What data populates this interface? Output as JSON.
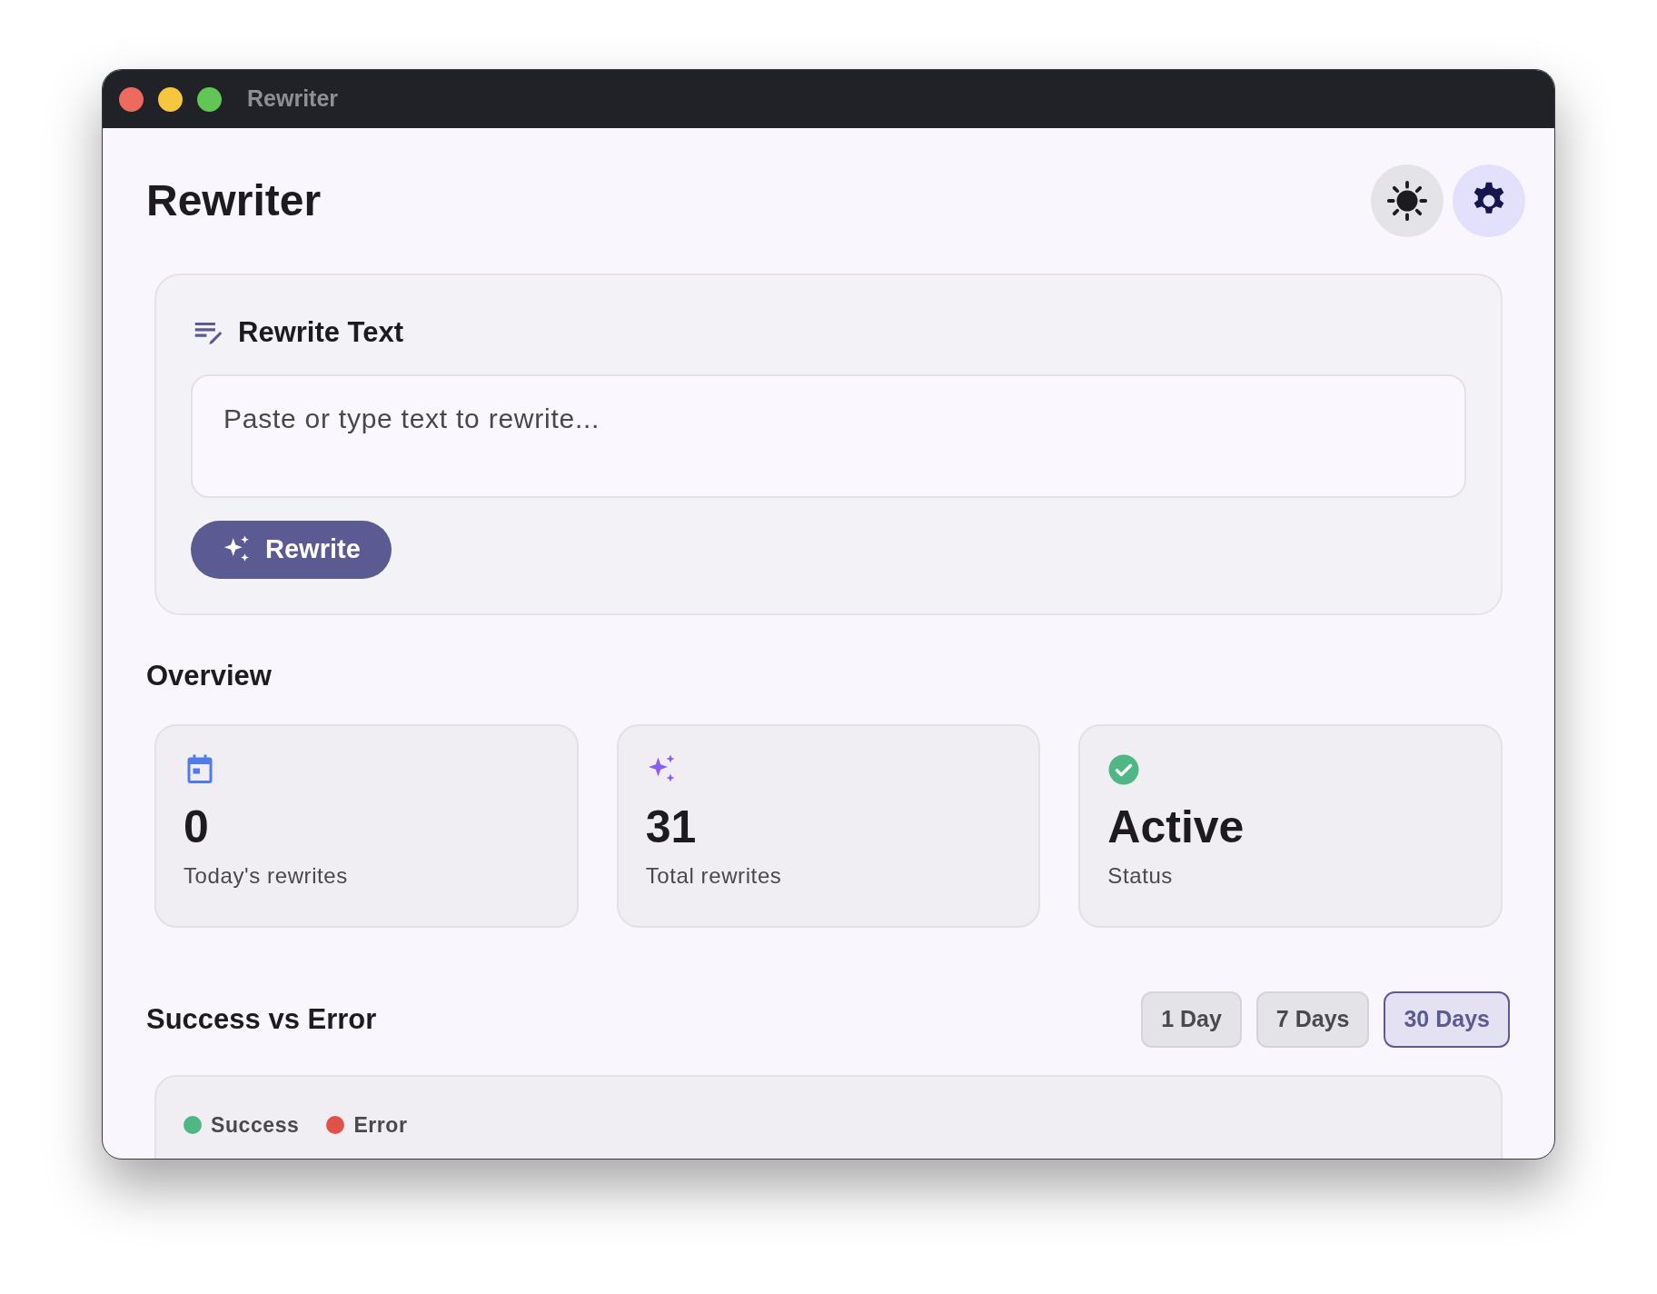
{
  "window": {
    "title": "Rewriter"
  },
  "header": {
    "title": "Rewriter"
  },
  "rewrite_card": {
    "title": "Rewrite Text",
    "input": {
      "placeholder": "Paste or type text to rewrite..."
    },
    "button": "Rewrite"
  },
  "overview": {
    "title": "Overview",
    "stats": [
      {
        "kind": "calendar",
        "value": "0",
        "label": "Today's rewrites"
      },
      {
        "kind": "sparkles",
        "value": "31",
        "label": "Total rewrites"
      },
      {
        "kind": "check",
        "value": "Active",
        "label": "Status"
      }
    ]
  },
  "success_vs_error": {
    "title": "Success vs Error",
    "ranges": [
      {
        "label": "1 Day",
        "selected": false
      },
      {
        "label": "7 Days",
        "selected": false
      },
      {
        "label": "30 Days",
        "selected": true
      }
    ],
    "legend": [
      {
        "label": "Success",
        "color": "#4fb783"
      },
      {
        "label": "Error",
        "color": "#e0514b"
      }
    ]
  }
}
